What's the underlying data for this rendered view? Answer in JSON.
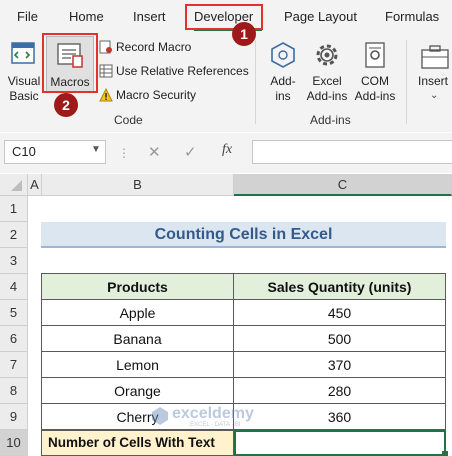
{
  "ribbon": {
    "tabs": [
      "File",
      "Home",
      "Insert",
      "Developer",
      "Page Layout",
      "Formulas"
    ],
    "active_tab": "Developer",
    "step_badges": [
      "1",
      "2"
    ],
    "code_group": {
      "visual_basic_line1": "Visual",
      "visual_basic_line2": "Basic",
      "macros": "Macros",
      "record_macro": "Record Macro",
      "use_relative_references": "Use Relative References",
      "macro_security": "Macro Security",
      "label": "Code"
    },
    "addins_group": {
      "addins_line1": "Add-",
      "addins_line2": "ins",
      "excel_addins_line1": "Excel",
      "excel_addins_line2": "Add-ins",
      "com_addins_line1": "COM",
      "com_addins_line2": "Add-ins",
      "label": "Add-ins"
    },
    "insert_label": "Insert",
    "accent_color": "#e0332c",
    "badge_color": "#9e1a1a"
  },
  "formula_bar": {
    "name_box": "C10",
    "fx": "fx",
    "cancel": "✕",
    "confirm": "✓",
    "formula": ""
  },
  "grid": {
    "columns": [
      "A",
      "B",
      "C"
    ],
    "rows": [
      "1",
      "2",
      "3",
      "4",
      "5",
      "6",
      "7",
      "8",
      "9",
      "10"
    ],
    "title": "Counting Cells in Excel",
    "headers": [
      "Products",
      "Sales Quantity (units)"
    ],
    "products": [
      "Apple",
      "Banana",
      "Lemon",
      "Orange",
      "Cherry"
    ],
    "quantities": [
      "450",
      "500",
      "370",
      "280",
      "360"
    ],
    "summary_label": "Number of Cells With Text",
    "summary_value": "",
    "title_fill": "#dce6f1",
    "title_color": "#335b8a",
    "header_fill": "#e2efda",
    "summary_fill": "#fff2cc",
    "selected_border": "#217346"
  },
  "watermark": {
    "name": "exceldemy",
    "tagline": "EXCEL · DATA · BI"
  }
}
